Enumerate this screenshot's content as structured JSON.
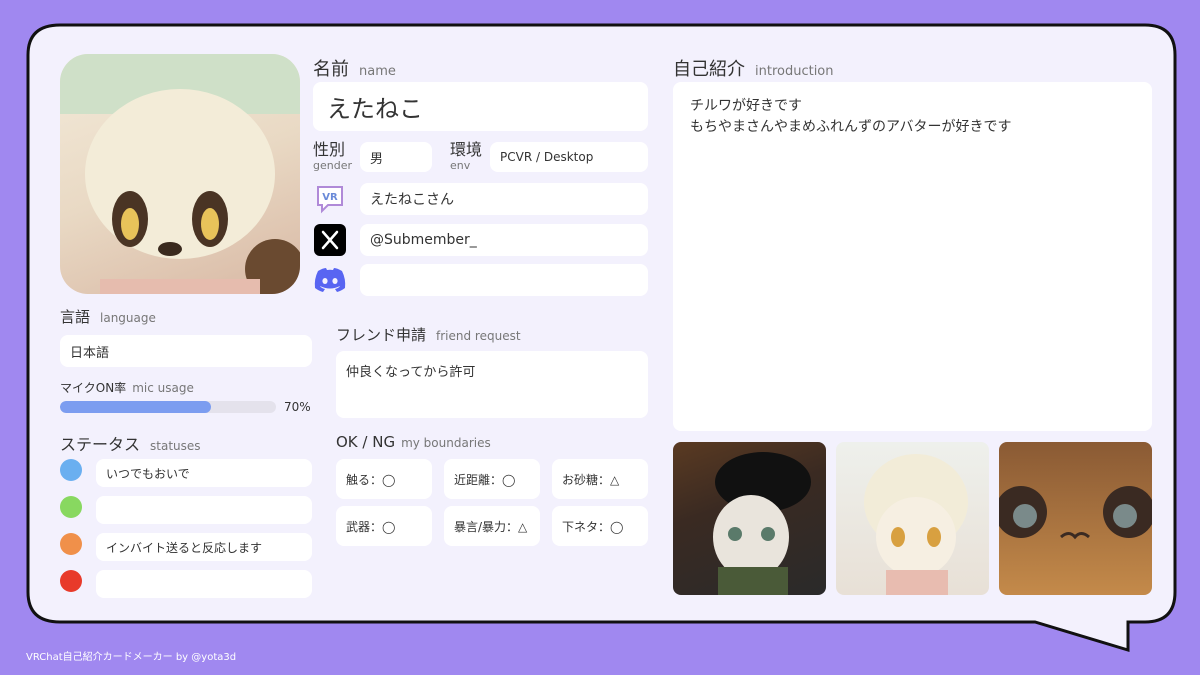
{
  "name": {
    "label": "名前",
    "sub": "name",
    "value": "えたねこ"
  },
  "gender": {
    "label": "性別",
    "sub": "gender",
    "value": "男"
  },
  "env": {
    "label": "環境",
    "sub": "env",
    "value": "PCVR / Desktop"
  },
  "vrchat": {
    "icon": "vrchat-icon",
    "value": "えたねこさん"
  },
  "x_account": {
    "icon": "x-logo-icon",
    "value": "@Submember_"
  },
  "discord": {
    "icon": "discord-icon",
    "value": ""
  },
  "introduction": {
    "label": "自己紹介",
    "sub": "introduction",
    "line1": "チルワが好きです",
    "line2": "もちやまさんやまめふれんずのアバターが好きです"
  },
  "language": {
    "label": "言語",
    "sub": "language",
    "value": "日本語"
  },
  "mic": {
    "label": "マイクON率",
    "sub": "mic usage",
    "percent": 70,
    "display": "70%"
  },
  "statuses": {
    "label": "ステータス",
    "sub": "statuses",
    "items": [
      {
        "color": "#6aaff0",
        "text": "いつでもおいで"
      },
      {
        "color": "#88d860",
        "text": ""
      },
      {
        "color": "#f0904a",
        "text": "インバイト送ると反応します"
      },
      {
        "color": "#e83a2a",
        "text": ""
      }
    ]
  },
  "friend_request": {
    "label": "フレンド申請",
    "sub": "friend request",
    "value": "仲良くなってから許可"
  },
  "boundaries": {
    "label": "OK / NG",
    "sub": "my boundaries",
    "items": [
      "触る：◯",
      "近距離：◯",
      "お砂糖：△",
      "武器：◯",
      "暴言/暴力：△",
      "下ネタ：◯"
    ]
  },
  "footer": "VRChat自己紹介カードメーカー by @yota3d",
  "colors": {
    "accent": "#a088f0",
    "card": "#f3f1fd",
    "mic_bar": "#7c9df0"
  }
}
